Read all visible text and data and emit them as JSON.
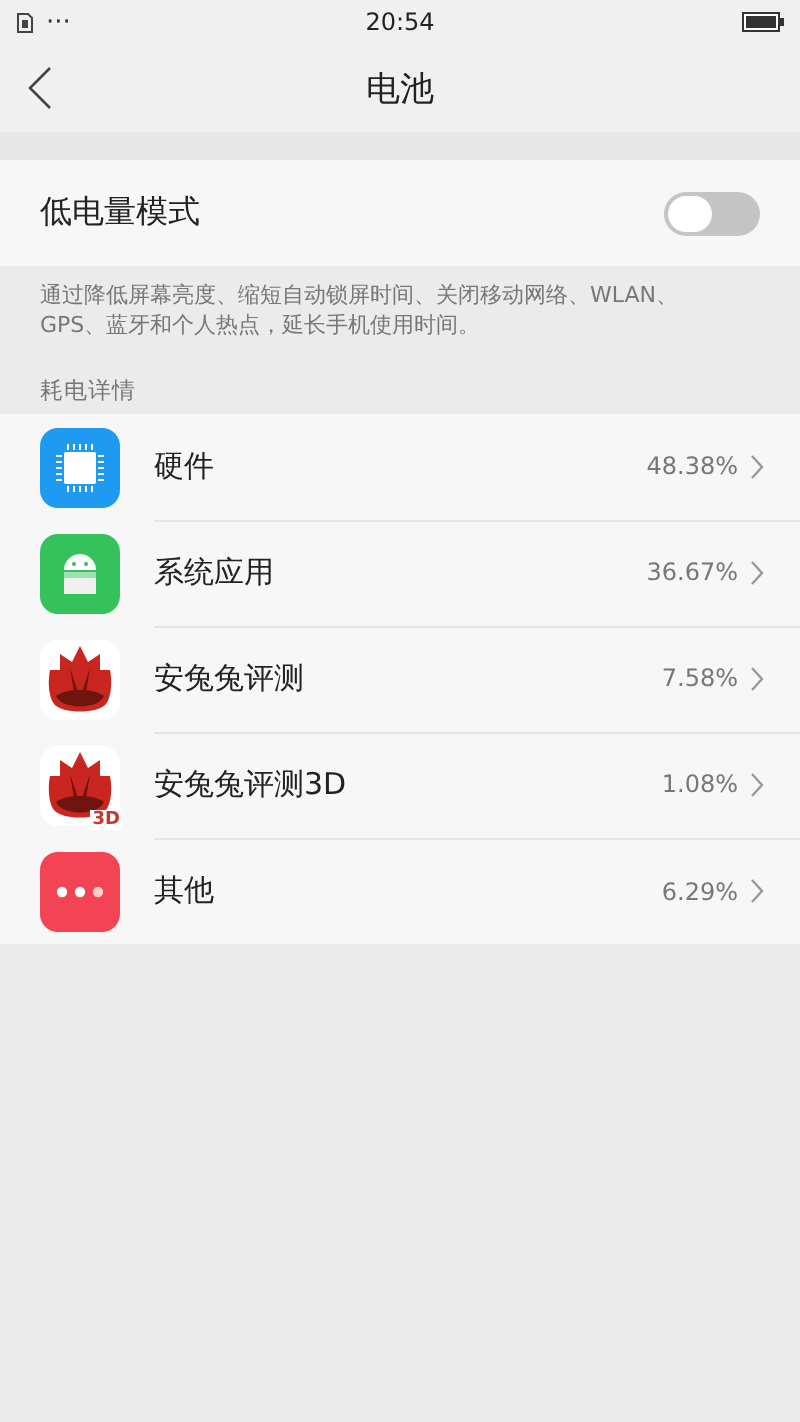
{
  "status_bar": {
    "dots": "···",
    "time": "20:54"
  },
  "header": {
    "title": "电池"
  },
  "low_power": {
    "label": "低电量模式",
    "on": false
  },
  "description": "通过降低屏幕亮度、缩短自动锁屏时间、关闭移动网络、WLAN、GPS、蓝牙和个人热点，延长手机使用时间。",
  "section_title": "耗电详情",
  "items": [
    {
      "kind": "chip",
      "name": "硬件",
      "percent": "48.38%"
    },
    {
      "kind": "android",
      "name": "系统应用",
      "percent": "36.67%"
    },
    {
      "kind": "flame",
      "name": "安兔兔评测",
      "percent": "7.58%"
    },
    {
      "kind": "flame",
      "badge": "3D",
      "name": "安兔兔评测3D",
      "percent": "1.08%"
    },
    {
      "kind": "more",
      "name": "其他",
      "percent": "6.29%"
    }
  ]
}
